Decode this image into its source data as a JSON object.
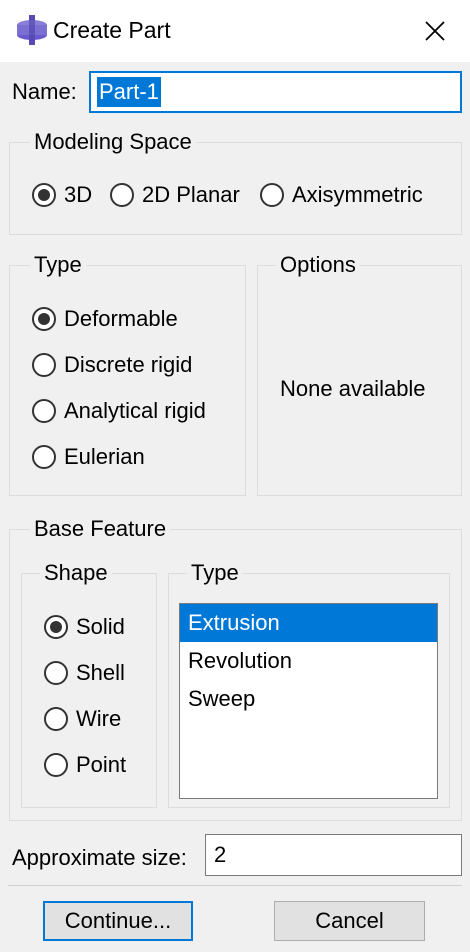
{
  "window": {
    "title": "Create Part"
  },
  "name": {
    "label": "Name:",
    "value": "Part-1"
  },
  "modeling_space": {
    "legend": "Modeling Space",
    "options": [
      "3D",
      "2D Planar",
      "Axisymmetric"
    ],
    "selected": "3D"
  },
  "type": {
    "legend": "Type",
    "options": [
      "Deformable",
      "Discrete rigid",
      "Analytical rigid",
      "Eulerian"
    ],
    "selected": "Deformable"
  },
  "options": {
    "legend": "Options",
    "text": "None available"
  },
  "base_feature": {
    "legend": "Base Feature",
    "shape": {
      "legend": "Shape",
      "options": [
        "Solid",
        "Shell",
        "Wire",
        "Point"
      ],
      "selected": "Solid"
    },
    "type": {
      "legend": "Type",
      "items": [
        "Extrusion",
        "Revolution",
        "Sweep"
      ],
      "selected": "Extrusion"
    }
  },
  "approximate_size": {
    "label": "Approximate size:",
    "value": "2"
  },
  "buttons": {
    "continue": "Continue...",
    "cancel": "Cancel"
  },
  "colors": {
    "accent": "#0078d7",
    "background": "#f0f0f0",
    "icon": "#6a5acd"
  }
}
